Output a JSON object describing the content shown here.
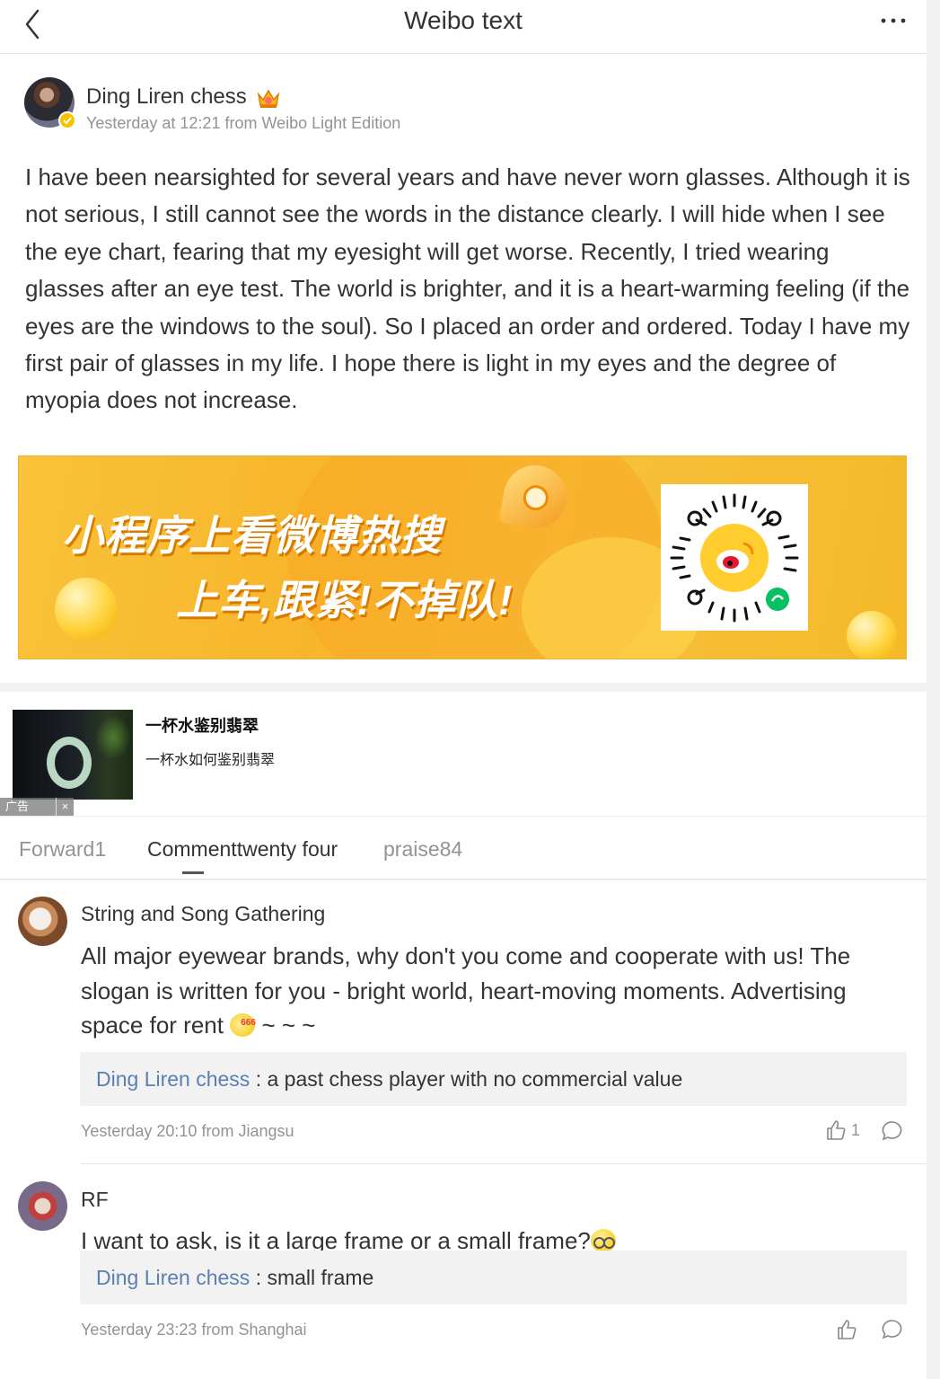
{
  "header": {
    "title": "Weibo text",
    "back_icon": "chevron-left-icon",
    "more_icon": "more-horizontal-icon"
  },
  "post": {
    "author": "Ding Liren chess",
    "author_badge_icon": "crown-badge-icon",
    "verified_icon": "verified-badge-icon",
    "meta": "Yesterday at 12:21 from Weibo Light Edition",
    "text": "I have been nearsighted for several years and have never worn glasses. Although it is not serious, I still cannot see the words in the distance clearly. I will hide when I see the eye chart, fearing that my eyesight will get worse. Recently, I tried wearing glasses after an eye test. The world is brighter, and it is a heart-warming feeling (if the eyes are the windows to the soul). So I placed an order and ordered. Today I have my first pair of glasses in my life. I hope there is light in my eyes and the degree of myopia does not increase."
  },
  "banner": {
    "line1": "小程序上看微博热搜",
    "line2": "上车,跟紧!不掉队!",
    "qr_icon": "weibo-qr-code-icon",
    "accent_color": "#f7b52b"
  },
  "ad": {
    "title": "一杯水鉴别翡翠",
    "subtitle": "一杯水如何鉴别翡翠",
    "tag": "广告",
    "close": "×"
  },
  "tabs": [
    {
      "label": "Forward1"
    },
    {
      "label": "Commenttwenty four"
    },
    {
      "label": "praise84"
    }
  ],
  "comments": [
    {
      "name": "String and Song Gathering",
      "text": "All major eyewear brands, why don't you come and cooperate with us! The slogan is written for you - bright world, heart-moving moments. Advertising space for rent",
      "emoji_tag": "666",
      "tail": "~ ~ ~",
      "reply_name": "Ding Liren chess",
      "reply_text": " : a past chess player with no commercial value",
      "meta": "Yesterday 20:10 from Jiangsu",
      "likes": "1"
    },
    {
      "name": "RF",
      "text": "I want to ask, is it a large frame or a small frame?",
      "reply_name": "Ding Liren chess",
      "reply_text": " : small frame",
      "meta": "Yesterday 23:23 from Shanghai",
      "likes": ""
    }
  ]
}
